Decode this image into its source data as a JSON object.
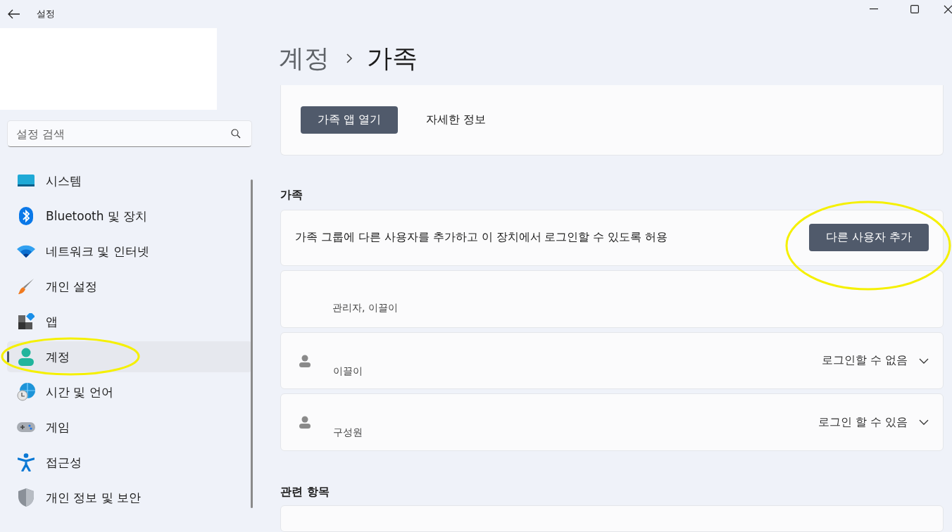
{
  "window": {
    "title": "설정"
  },
  "sidebar": {
    "search": {
      "placeholder": "설정 검색"
    },
    "items": [
      {
        "label": "시스템",
        "selected": false
      },
      {
        "label": "Bluetooth 및 장치",
        "selected": false
      },
      {
        "label": "네트워크 및 인터넷",
        "selected": false
      },
      {
        "label": "개인 설정",
        "selected": false
      },
      {
        "label": "앱",
        "selected": false
      },
      {
        "label": "계정",
        "selected": true
      },
      {
        "label": "시간 및 언어",
        "selected": false
      },
      {
        "label": "게임",
        "selected": false
      },
      {
        "label": "접근성",
        "selected": false
      },
      {
        "label": "개인 정보 및 보안",
        "selected": false
      }
    ]
  },
  "breadcrumb": [
    "계정",
    "가족"
  ],
  "top_card": {
    "button": "가족 앱 열기",
    "link": "자세한 정보"
  },
  "family": {
    "title": "가족",
    "add_row": {
      "text": "가족 그룹에 다른 사용자를 추가하고 이 장치에서 로그인할 수 있도록 허용",
      "button": "다른 사용자 추가"
    },
    "members": [
      {
        "kind": "owner",
        "role": "관리자, 이끌이"
      },
      {
        "kind": "member",
        "role": "이끌이",
        "status": "로그인할 수 없음",
        "expanded": false
      },
      {
        "kind": "member",
        "role": "구성원",
        "status": "로그인 할 수 있음",
        "expanded": false
      }
    ]
  },
  "related": {
    "title": "관련 항목"
  }
}
